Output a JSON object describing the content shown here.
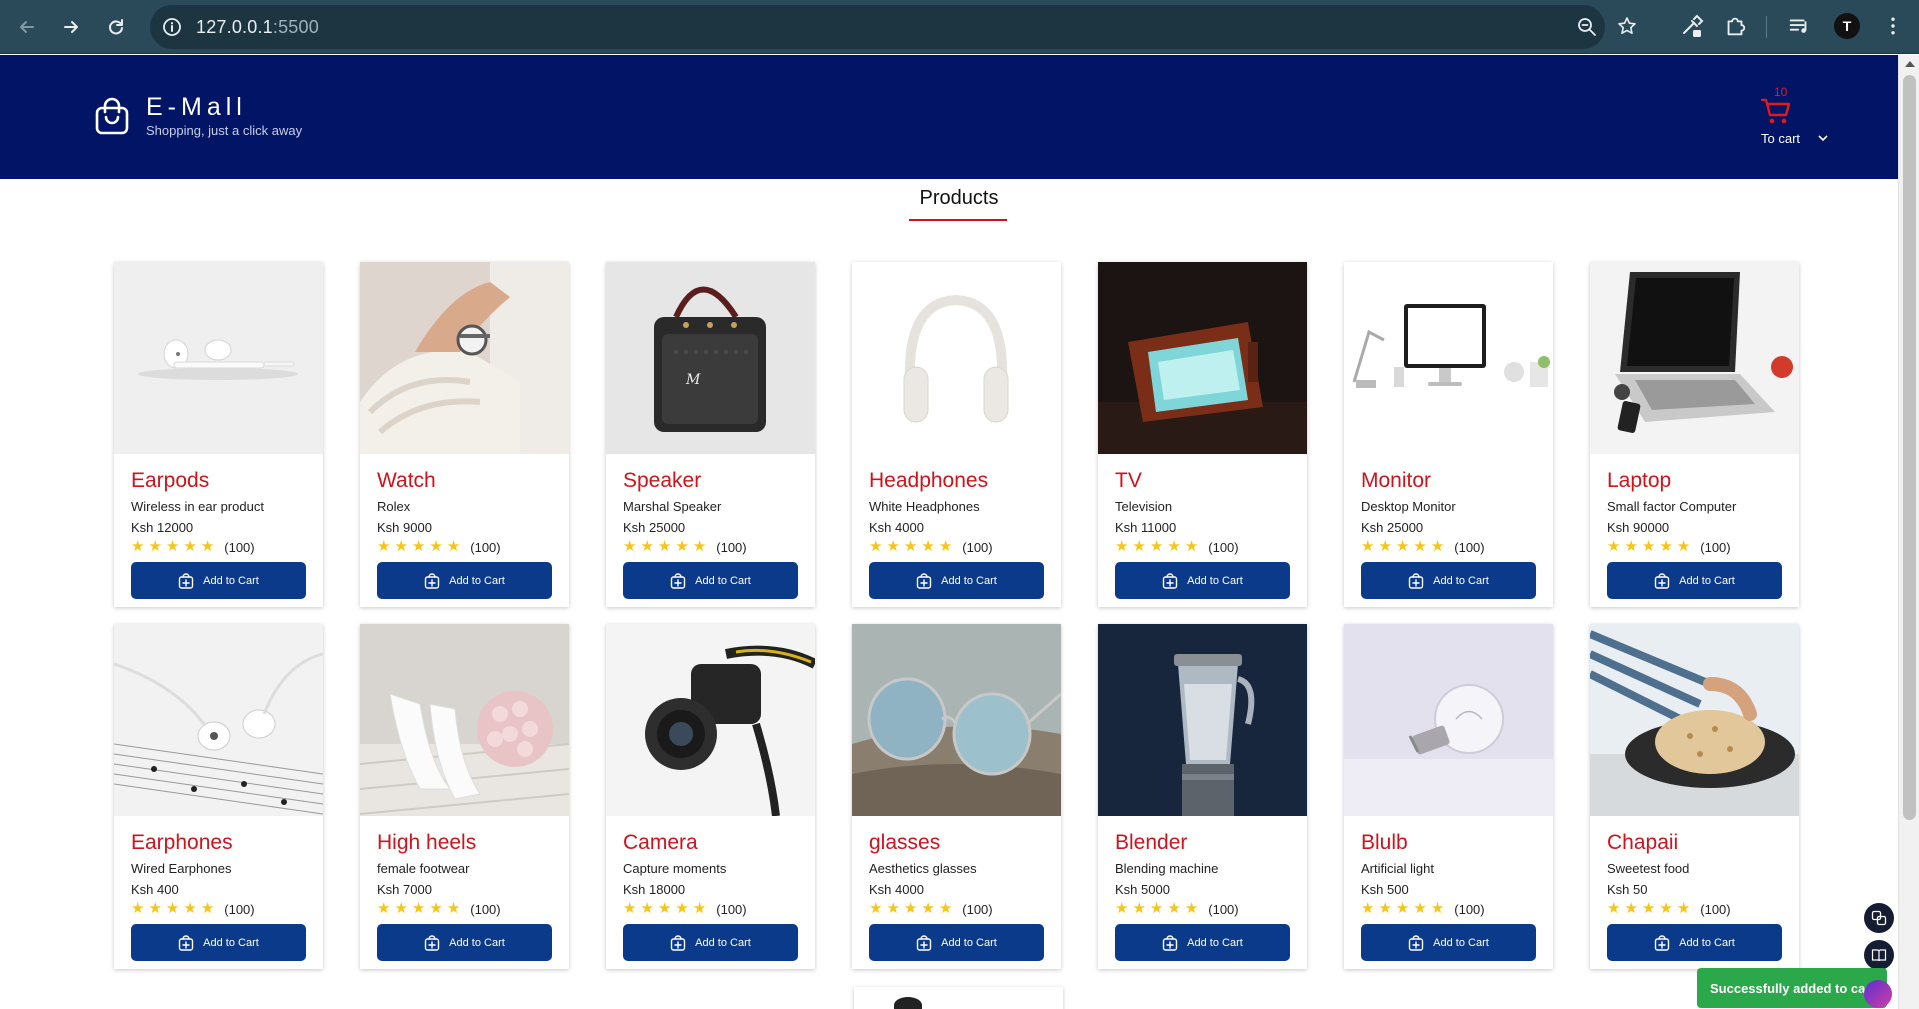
{
  "browser": {
    "url_host": "127.0.0.1",
    "url_port": ":5500",
    "profile_initial": "T"
  },
  "header": {
    "brand_name": "E-Mall",
    "tagline": "Shopping, just a click away",
    "cart_count": "10",
    "cart_label": "To cart"
  },
  "section": {
    "title": "Products"
  },
  "colors": {
    "header_bg": "#021466",
    "accent_red": "#d0131b",
    "button_blue": "#0c3a8b",
    "star": "#f5c518",
    "toast_green": "#2aa84a"
  },
  "products": [
    {
      "title": "Earpods",
      "desc": "Wireless in ear product",
      "price": "Ksh 12000",
      "rating_count": "(100)",
      "button": "Add to Cart",
      "image": "earpods-image"
    },
    {
      "title": "Watch",
      "desc": "Rolex",
      "price": "Ksh 9000",
      "rating_count": "(100)",
      "button": "Add to Cart",
      "image": "watch-image"
    },
    {
      "title": "Speaker",
      "desc": "Marshal Speaker",
      "price": "Ksh 25000",
      "rating_count": "(100)",
      "button": "Add to Cart",
      "image": "speaker-image"
    },
    {
      "title": "Headphones",
      "desc": "White Headphones",
      "price": "Ksh 4000",
      "rating_count": "(100)",
      "button": "Add to Cart",
      "image": "headphones-image"
    },
    {
      "title": "TV",
      "desc": "Television",
      "price": "Ksh 11000",
      "rating_count": "(100)",
      "button": "Add to Cart",
      "image": "tv-image"
    },
    {
      "title": "Monitor",
      "desc": "Desktop Monitor",
      "price": "Ksh 25000",
      "rating_count": "(100)",
      "button": "Add to Cart",
      "image": "monitor-image"
    },
    {
      "title": "Laptop",
      "desc": "Small factor Computer",
      "price": "Ksh 90000",
      "rating_count": "(100)",
      "button": "Add to Cart",
      "image": "laptop-image"
    },
    {
      "title": "Earphones",
      "desc": "Wired Earphones",
      "price": "Ksh 400",
      "rating_count": "(100)",
      "button": "Add to Cart",
      "image": "earphones-image"
    },
    {
      "title": "High heels",
      "desc": "female footwear",
      "price": "Ksh 7000",
      "rating_count": "(100)",
      "button": "Add to Cart",
      "image": "high-heels-image"
    },
    {
      "title": "Camera",
      "desc": "Capture moments",
      "price": "Ksh 18000",
      "rating_count": "(100)",
      "button": "Add to Cart",
      "image": "camera-image"
    },
    {
      "title": "glasses",
      "desc": "Aesthetics glasses",
      "price": "Ksh 4000",
      "rating_count": "(100)",
      "button": "Add to Cart",
      "image": "glasses-image"
    },
    {
      "title": "Blender",
      "desc": "Blending machine",
      "price": "Ksh 5000",
      "rating_count": "(100)",
      "button": "Add to Cart",
      "image": "blender-image"
    },
    {
      "title": "Blulb",
      "desc": "Artificial light",
      "price": "Ksh 500",
      "rating_count": "(100)",
      "button": "Add to Cart",
      "image": "bulb-image"
    },
    {
      "title": "Chapaii",
      "desc": "Sweetest food",
      "price": "Ksh 50",
      "rating_count": "(100)",
      "button": "Add to Cart",
      "image": "chapati-image"
    }
  ],
  "toast": {
    "message": "Successfully added to cart"
  }
}
